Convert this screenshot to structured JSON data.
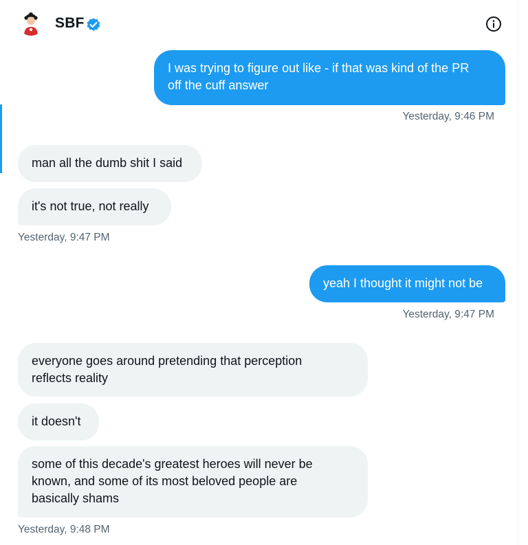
{
  "header": {
    "name": "SBF",
    "avatar_icon": "avatar-icon",
    "verified_icon": "verified-badge-icon",
    "info_icon": "info-icon"
  },
  "colors": {
    "sent_bubble": "#1d9bf0",
    "received_bubble": "#eff3f4",
    "timestamp": "#536471",
    "verified": "#1d9bf0"
  },
  "messages": [
    {
      "direction": "sent",
      "lines": [
        "I was trying to figure out like - if that was kind of the PR",
        "off the cuff answer"
      ]
    },
    {
      "direction": "sent-time",
      "text": "Yesterday, 9:46 PM"
    },
    {
      "direction": "received",
      "lines": [
        "man all the dumb shit I said"
      ]
    },
    {
      "direction": "received",
      "lines": [
        "it's not true, not really"
      ]
    },
    {
      "direction": "received-time",
      "text": "Yesterday, 9:47 PM"
    },
    {
      "direction": "sent",
      "lines": [
        "yeah I thought it might not be"
      ]
    },
    {
      "direction": "sent-time",
      "text": "Yesterday, 9:47 PM"
    },
    {
      "direction": "received",
      "lines": [
        "everyone goes around pretending that perception",
        "reflects reality"
      ]
    },
    {
      "direction": "received",
      "lines": [
        "it doesn't"
      ]
    },
    {
      "direction": "received",
      "lines": [
        "some of this decade's greatest heroes will never be",
        "known, and some of its most beloved people are",
        "basically shams"
      ]
    },
    {
      "direction": "received-time",
      "text": "Yesterday, 9:48 PM"
    }
  ]
}
